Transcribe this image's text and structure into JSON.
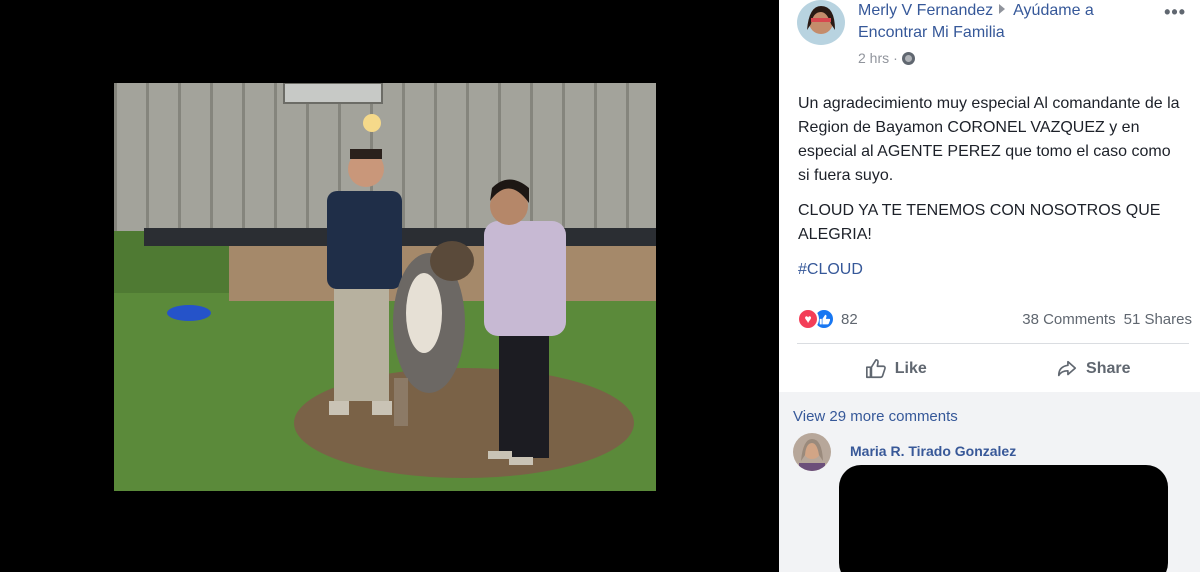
{
  "post": {
    "author": "Merly V Fernandez",
    "group": "Ayúdame a Encontrar Mi Familia",
    "time": "2 hrs",
    "more_icon": "more-horizontal-icon",
    "privacy_icon": "globe-icon",
    "body": {
      "paragraph1": "Un agradecimiento muy especial Al comandante de la Region de Bayamon CORONEL VAZQUEZ y en especial al AGENTE PEREZ que tomo el caso como si fuera suyo.",
      "paragraph2": "CLOUD YA TE TENEMOS CON NOSOTROS QUE ALEGRIA!",
      "hashtag": "#CLOUD"
    }
  },
  "reactions": {
    "count": "82",
    "comments": "38 Comments",
    "shares": "51 Shares",
    "icons": [
      "heart-icon",
      "like-icon"
    ]
  },
  "actions": {
    "like": "Like",
    "share": "Share"
  },
  "comments": {
    "view_more": "View 29 more comments",
    "first_author": "Maria R. Tirado Gonzalez"
  },
  "colors": {
    "link": "#365899",
    "heart": "#f33e58",
    "like": "#1877f2",
    "panel": "#ffffff",
    "comments_bg": "#f2f3f5"
  }
}
